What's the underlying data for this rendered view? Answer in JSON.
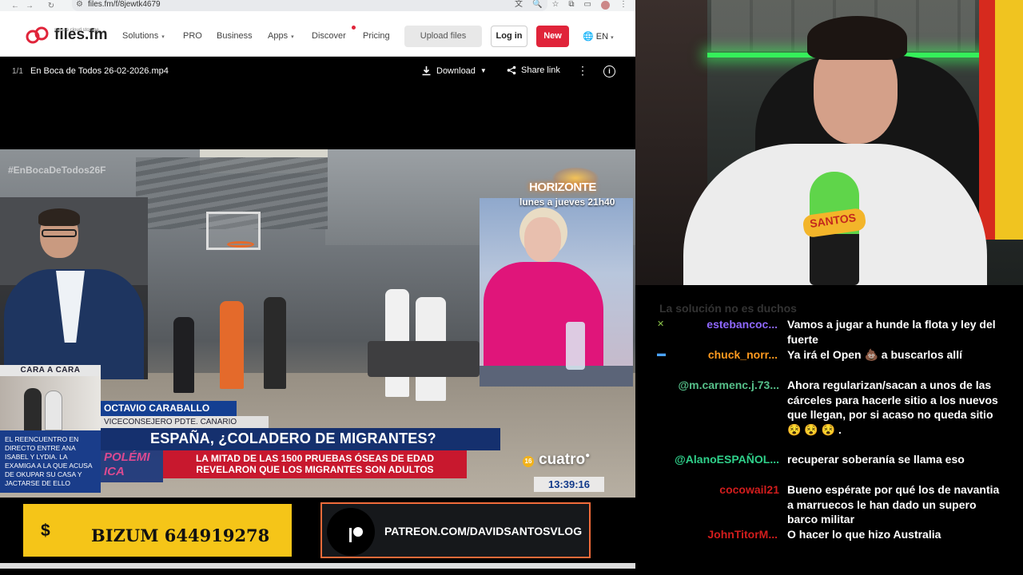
{
  "browser": {
    "url": "files.fm/f/8jewtk4679",
    "site": {
      "logo_text": "files.fm",
      "logo_sub": "secure cloud storage",
      "nav": [
        {
          "label": "Solutions",
          "caret": "▾"
        },
        {
          "label": "PRO"
        },
        {
          "label": "Business"
        },
        {
          "label": "Apps",
          "caret": "▾"
        },
        {
          "label": "Discover"
        },
        {
          "label": "Pricing"
        }
      ],
      "upload_label": "Upload files",
      "login_label": "Log in",
      "new_label": "New",
      "lang_label": "EN",
      "brand_color": "#e0243a"
    },
    "file": {
      "count": "1/1",
      "name": "En Boca de Todos 26-02-2026.mp4",
      "download_label": "Download",
      "share_label": "Share link"
    }
  },
  "video": {
    "hashtag": "#EnBocaDeTodos26F",
    "promo_title": "HORIZONTE",
    "promo_sub": "lunes a jueves 21h40",
    "cara_tag": "CARA A CARA",
    "cara_text": "EL REENCUENTRO EN DIRECTO ENTRE ANA ISABEL Y LYDIA. LA EXAMIGA A LA QUE ACUSA DE OKUPAR SU CASA Y JACTARSE DE ELLO",
    "name_title": "OCTAVIO CARABALLO",
    "name_sub": "VICECONSEJERO PDTE. CANARIO",
    "headline": "ESPAÑA, ¿COLADERO DE MIGRANTES?",
    "ghost_left": "POLÉMI\nICA",
    "subline": "LA MITAD DE LAS 1500 PRUEBAS ÓSEAS DE EDAD\nREVELARON QUE LOS MIGRANTES SON ADULTOS",
    "channel": "cuatro",
    "age_rating": "16",
    "clock": "13:39:16"
  },
  "sponsor": {
    "bizum_symbol": "$",
    "bizum_text": "BIZUM 644919278",
    "patreon_text": "PATREON.COM/DAVIDSANTOSVLOG"
  },
  "webcam": {
    "mic_label": "SANTOS"
  },
  "chat": {
    "faded_line": "La solución no es duchos",
    "messages": [
      {
        "user": "estebancoc...",
        "color": "#8f68ff",
        "icons": [
          "👁",
          "✕"
        ],
        "text": "Vamos a jugar a hunde la flota y ley del fuerte"
      },
      {
        "user": "chuck_norr...",
        "color": "#ff9a1f",
        "icons": [
          "🎟",
          "▬"
        ],
        "text": "Ya irá el Open 💩 a buscarlos allí"
      },
      {
        "user": "@m.carmenc.j.73...",
        "color": "#56c08a",
        "icons": [],
        "text": "Ahora regularizan/sacan a unos de las cárceles para hacerle sitio a los nuevos que llegan, por si acaso no queda sitio 😵 😵 😵 ."
      },
      {
        "user": "@AlanoESPAÑOL...",
        "color": "#2fd08a",
        "icons": [],
        "text": "recuperar soberanía se llama eso"
      },
      {
        "user": "cocowail21",
        "color": "#d21d1d",
        "icons": [],
        "text": "Bueno espérate por qué los de navantia a marruecos le han dado un supero barco militar"
      },
      {
        "user": "JohnTitorM...",
        "color": "#d21d1d",
        "icons": [
          "👁",
          "🛡"
        ],
        "text": "O hacer lo que hizo Australia"
      }
    ]
  }
}
